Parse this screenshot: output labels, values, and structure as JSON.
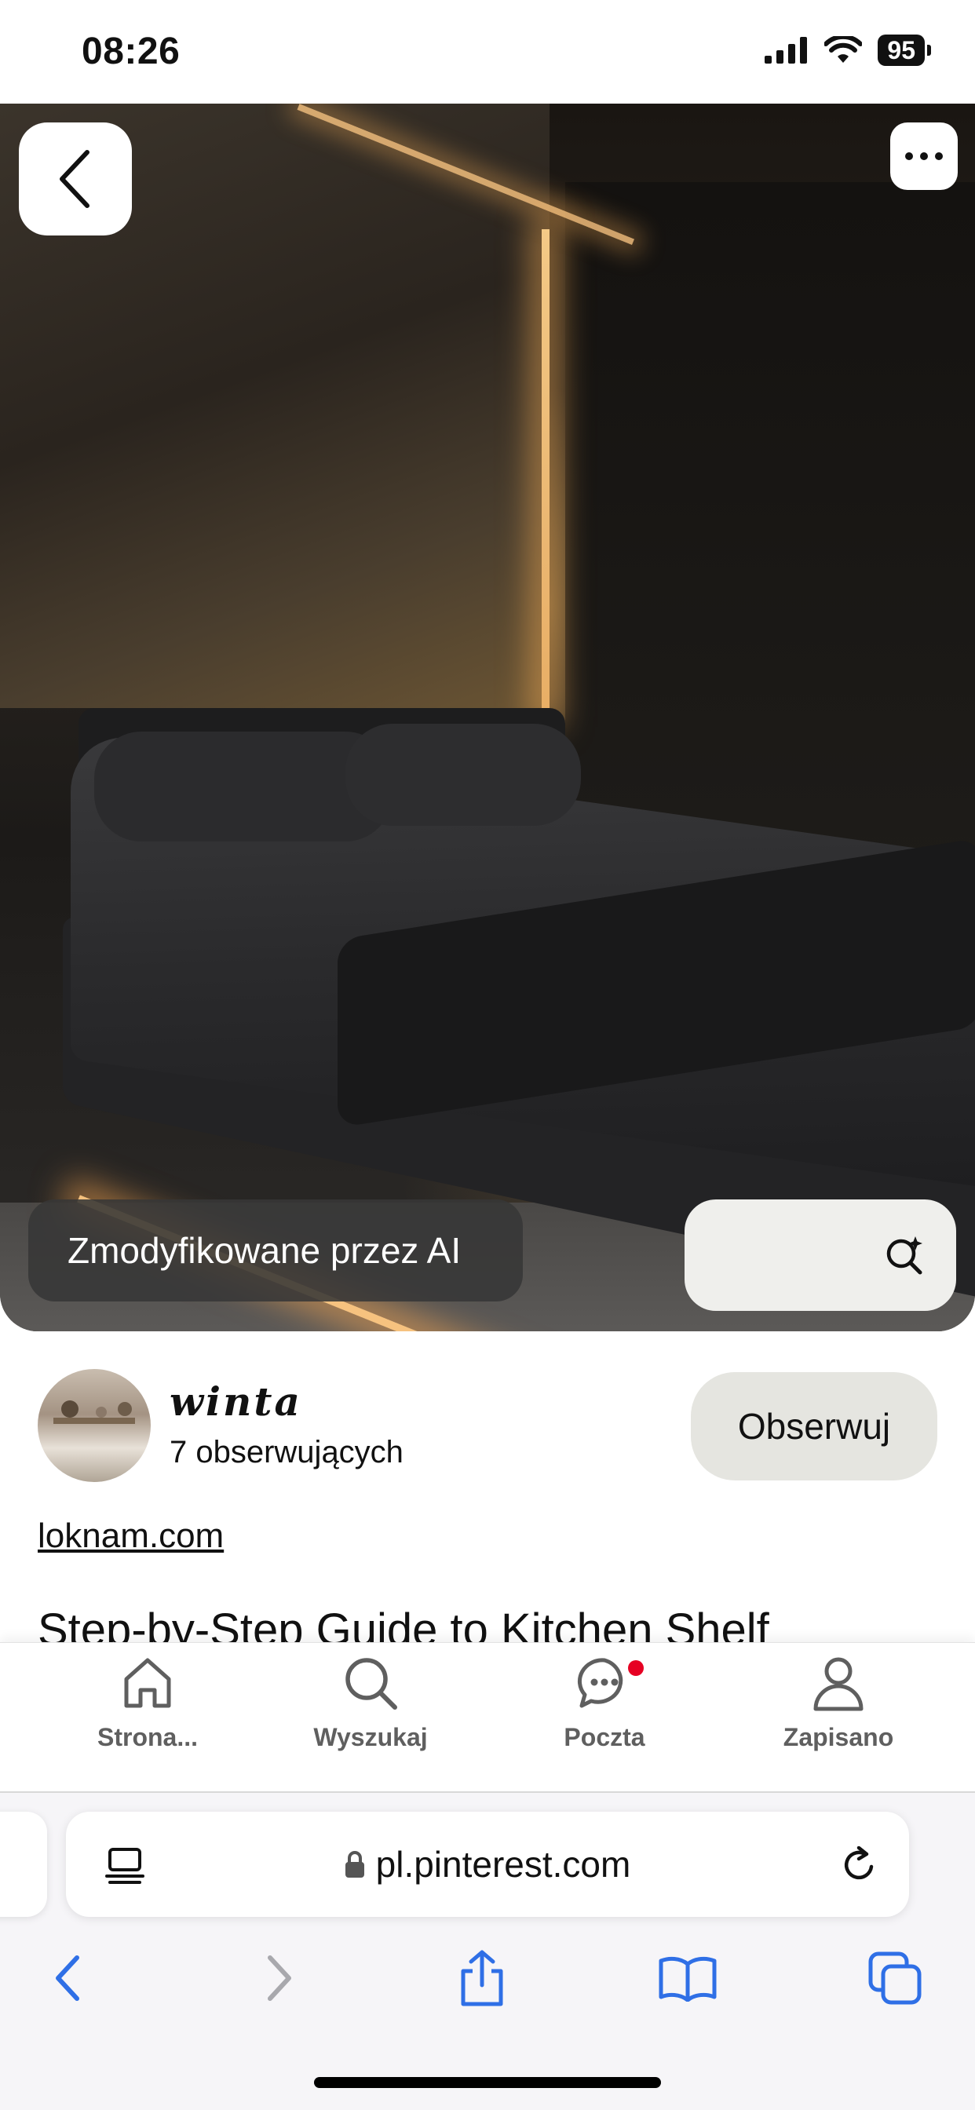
{
  "status_bar": {
    "time": "08:26",
    "battery": "95"
  },
  "pin": {
    "ai_label": "Zmodyfikowane przez AI",
    "creator_name": "winta",
    "followers": "7 obserwujących",
    "follow_label": "Obserwuj",
    "source": "loknam.com",
    "title": "Step-by-Step Guide to Kitchen Shelf"
  },
  "bottom_nav": {
    "items": [
      {
        "label": "Strona...",
        "icon": "home-icon"
      },
      {
        "label": "Wyszukaj",
        "icon": "search-icon"
      },
      {
        "label": "Poczta",
        "icon": "chat-icon",
        "has_notification": true
      },
      {
        "label": "Zapisano",
        "icon": "profile-icon"
      }
    ]
  },
  "browser": {
    "url": "pl.pinterest.com"
  },
  "colors": {
    "accent": "#e60023",
    "safari_blue": "#2f6fe6",
    "button_bg": "#e5e5e0"
  }
}
